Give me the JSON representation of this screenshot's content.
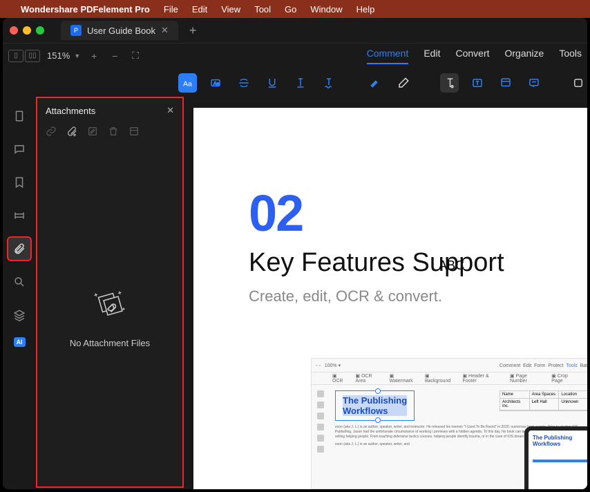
{
  "menubar": {
    "app": "Wondershare PDFelement Pro",
    "items": [
      "File",
      "Edit",
      "View",
      "Tool",
      "Go",
      "Window",
      "Help"
    ]
  },
  "tab": {
    "title": "User Guide Book"
  },
  "toolbar": {
    "zoom": "151%",
    "tabs": [
      "Comment",
      "Edit",
      "Convert",
      "Organize",
      "Tools"
    ],
    "active": "Comment"
  },
  "panel": {
    "title": "Attachments",
    "empty": "No Attachment Files"
  },
  "doc": {
    "num": "02",
    "abc": "ABC",
    "heading": "Key Features Support",
    "sub": "Create, edit, OCR & convert."
  },
  "preview": {
    "menu": [
      "Comment",
      "Edit",
      "Form",
      "Protect",
      "Tools",
      "Batch"
    ],
    "tools": [
      "OCR",
      "OCR Area",
      "Watermark",
      "Background",
      "Header & Footer",
      "Page Number",
      "Crop Page"
    ],
    "box_l1": "The Publishing",
    "box_l2": "Workflows",
    "tbl": {
      "h": [
        "Name",
        "Area Spaces",
        "Location"
      ],
      "r": [
        "Architects Inc.",
        "Left Hall",
        "Unknown"
      ]
    },
    "tablet_l1": "The Publishing",
    "tablet_l2": "Workflows"
  }
}
